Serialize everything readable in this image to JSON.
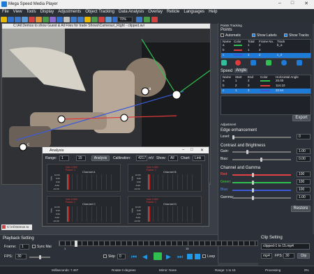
{
  "window": {
    "title": "Mega Speed Media Player",
    "min": "–",
    "max": "□",
    "close": "✕"
  },
  "menu": [
    "File",
    "View",
    "Tools",
    "Display",
    "Adjustments",
    "Object Tracking",
    "Data Analysis",
    "Overlay",
    "Reticle",
    "Languages",
    "Help"
  ],
  "toolbar_zoom": "70%",
  "video": {
    "title": "C:\\All Demos to show Guest & All Files for trade Shows\\Cameras\\_Right - clipped.avi"
  },
  "points": {
    "panel_title": "Points Tracking",
    "section": "Points",
    "automatic": "Automatic",
    "show_labels": "Show Labels",
    "show_tracks": "Show Tracks",
    "headers": [
      "Name",
      "Color",
      "Total",
      "Frame No.",
      "Track"
    ],
    "rows": [
      {
        "name": "a",
        "total": "1",
        "frame": "2",
        "track": "b_a"
      },
      {
        "name": "b",
        "total": "1",
        "frame": "2",
        "track": ""
      },
      {
        "name": "c",
        "total": "1",
        "frame": "2",
        "track": "c_2"
      }
    ]
  },
  "speed": {
    "tab_speed": "Speed",
    "tab_angle": "Angle",
    "headers": [
      "Name",
      "Start",
      "End",
      "Color",
      "Horizontal Angle"
    ],
    "rows": [
      {
        "name": "a",
        "start": "1",
        "end": "2",
        "angle": "20.00"
      },
      {
        "name": "b",
        "start": "2",
        "end": "3",
        "angle": "114.10"
      },
      {
        "name": "c",
        "start": "1",
        "end": "2",
        "angle": "32.54"
      }
    ],
    "export": "Export"
  },
  "adjustment": {
    "title": "Adjustment",
    "edge": "Edge enhancement",
    "level_label": "Level:",
    "level": "0",
    "contrast": "Contrast and Brightness",
    "gain_label": "Gain:",
    "gain": "1.00",
    "bias_label": "Bias:",
    "bias": "0.00",
    "channel": "Channel and Gamma",
    "red_label": "Red:",
    "red": "100",
    "green_label": "Green:",
    "green": "100",
    "blue_label": "Blue:",
    "blue": "100",
    "gamma_label": "Gamma:",
    "gamma": "1.00",
    "restore": "Restore"
  },
  "analysis": {
    "title": "Analysis",
    "range_label": "Range:",
    "range_from": "1",
    "range_to": "15",
    "analysis_btn": "Analysis",
    "calibration_label": "Calibration:",
    "calibration": "4217",
    "unit": "mV",
    "show_label": "Show:",
    "show": "All",
    "chart_label": "Chart:",
    "chart": "Link",
    "channels": [
      {
        "name": "Channel A",
        "v": "Volt: 0.000",
        "f": "Frame: 1",
        "ylabel": "Volts",
        "ticks": [
          "10.00",
          "5.00",
          "0.00",
          "-5.00",
          "-10.00"
        ]
      },
      {
        "name": "Channel B",
        "v": "Volt: 0.000",
        "f": "Frame: 1",
        "ylabel": "Volts",
        "ticks": [
          "10.00",
          "5.00",
          "0.00",
          "-5.00",
          "-10.00"
        ]
      },
      {
        "name": "Channel C",
        "v": "Volt: 0.000",
        "f": "Frame: 1",
        "ylabel": "Volts",
        "ticks": [
          "10.00",
          "5.00",
          "0.00",
          "-5.00",
          "-10.00"
        ]
      },
      {
        "name": "Channel D",
        "v": "Volt: 0.000",
        "f": "Frame: 1",
        "ylabel": "Volts",
        "ticks": [
          "10.00",
          "5.00",
          "0.00",
          "-5.00",
          "-10.00"
        ]
      }
    ]
  },
  "minimized": "C:\\All Demos to",
  "playback": {
    "title": "Playback Setting",
    "frame_label": "Frame:",
    "frame": "1",
    "sync": "Sync Mai",
    "fps_label": "FPS:",
    "fps": "30",
    "tick_start": "1",
    "tick_mid": "15",
    "skip_label": "Skip",
    "skip": "0",
    "loop": "Loop"
  },
  "clip": {
    "title": "Clip Setting",
    "file": "clipped-1 to 15.mp4",
    "format": "mp4",
    "fps_label": "FPS:",
    "fps": "30",
    "clip_btn": "Clip"
  },
  "status": {
    "ms": "Milliseconds: 7.467",
    "rotate": "Rotate 0 degrees",
    "mirror": "Mirror: None",
    "range": "Range: 1 to 15",
    "processing": "Processing",
    "percent": "0%"
  }
}
